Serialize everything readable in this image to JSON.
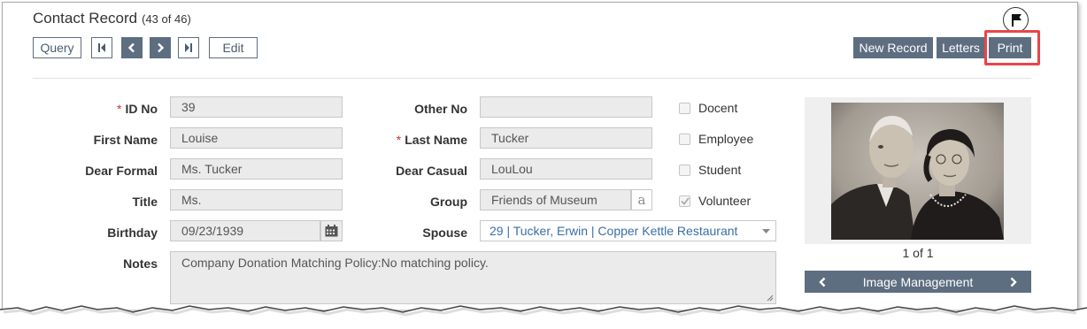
{
  "header": {
    "title": "Contact Record",
    "count": "(43 of 46)"
  },
  "toolbar": {
    "query": "Query",
    "edit": "Edit",
    "new_record": "New Record",
    "letters": "Letters",
    "print": "Print"
  },
  "form": {
    "id_no": {
      "label": "ID No",
      "value": "39"
    },
    "first_name": {
      "label": "First Name",
      "value": "Louise"
    },
    "dear_formal": {
      "label": "Dear Formal",
      "value": "Ms. Tucker"
    },
    "title": {
      "label": "Title",
      "value": "Ms."
    },
    "birthday": {
      "label": "Birthday",
      "value": "09/23/1939"
    },
    "notes": {
      "label": "Notes",
      "value": "Company Donation Matching Policy:No matching policy."
    },
    "other_no": {
      "label": "Other No",
      "value": ""
    },
    "last_name": {
      "label": "Last Name",
      "value": "Tucker"
    },
    "dear_casual": {
      "label": "Dear Casual",
      "value": "LouLou"
    },
    "group": {
      "label": "Group",
      "value": "Friends of Museum",
      "icon_text": "a"
    },
    "spouse": {
      "label": "Spouse",
      "value": "29 | Tucker, Erwin | Copper Kettle Restaurant"
    }
  },
  "checkboxes": [
    {
      "label": "Docent",
      "checked": false
    },
    {
      "label": "Employee",
      "checked": false
    },
    {
      "label": "Student",
      "checked": false
    },
    {
      "label": "Volunteer",
      "checked": true
    }
  ],
  "image_panel": {
    "count": "1 of 1",
    "button": "Image Management"
  },
  "colors": {
    "button_fill": "#5d6e80",
    "highlight": "#e8454a",
    "required": "#c0392b",
    "link": "#3a6ea5"
  },
  "icons": [
    "flag-icon",
    "first-record-icon",
    "prev-record-icon",
    "next-record-icon",
    "last-record-icon",
    "calendar-icon",
    "dropdown-arrow-icon",
    "resize-handle-icon",
    "chevron-left-icon",
    "chevron-right-icon"
  ]
}
